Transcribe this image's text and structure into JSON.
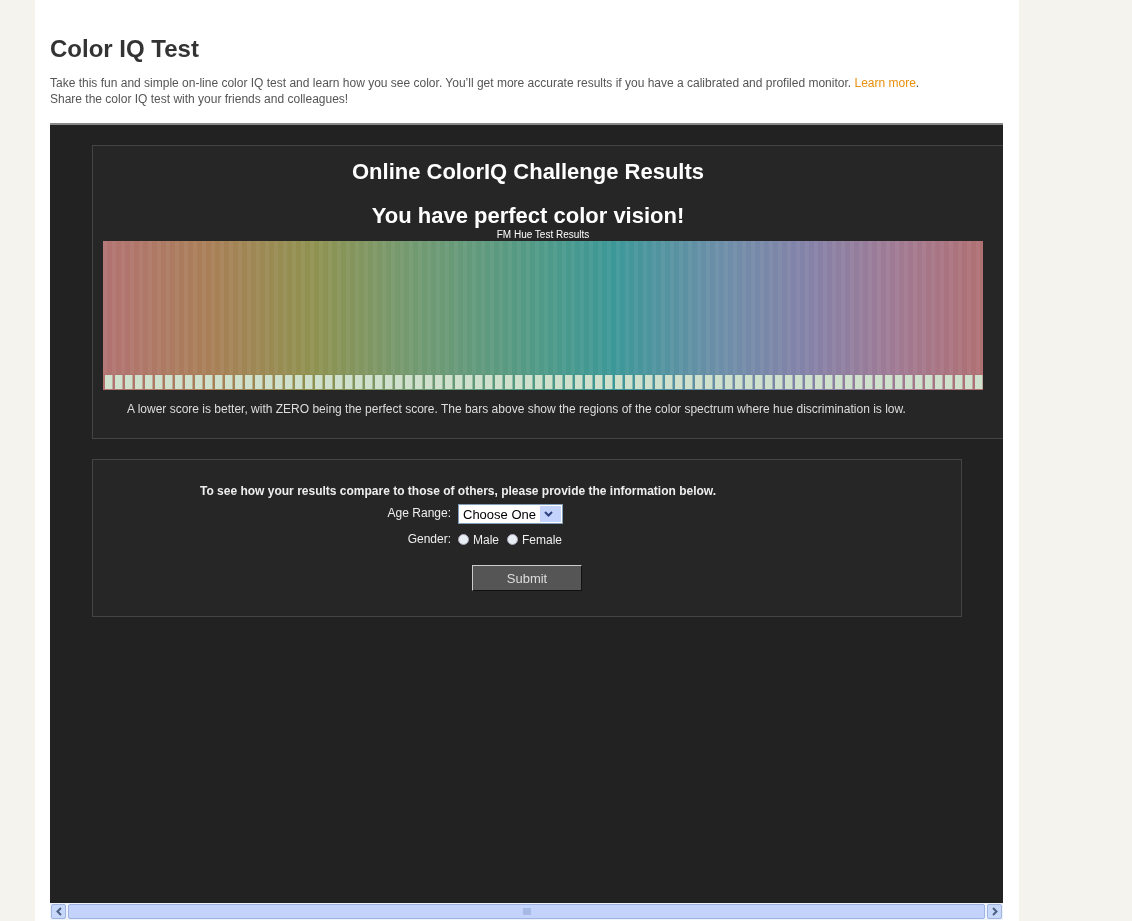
{
  "page": {
    "title": "Color IQ Test",
    "intro": {
      "before": "Take this fun and simple on-line color IQ test and learn how you see color. You’ll get more accurate results if you have a calibrated and profiled monitor. ",
      "link": "Learn more",
      "after": ".",
      "line_2": "Share the color IQ test with your friends and colleagues!"
    }
  },
  "results": {
    "heading": "Online ColorIQ Challenge Results",
    "verdict": "You have perfect color vision!",
    "chart_title": "FM Hue Test Results",
    "note": "A lower score is better, with ZERO being the perfect score. The bars above show the regions of the color spectrum where hue discrimination is low."
  },
  "form": {
    "prompt": "To see how your results compare to those of others, please provide the information below.",
    "age_label": "Age Range:",
    "age_value": "Choose One",
    "gender_label": "Gender:",
    "gender_options": [
      {
        "label": "Male",
        "selected": false
      },
      {
        "label": "Female",
        "selected": false
      }
    ],
    "submit": "Submit"
  }
}
